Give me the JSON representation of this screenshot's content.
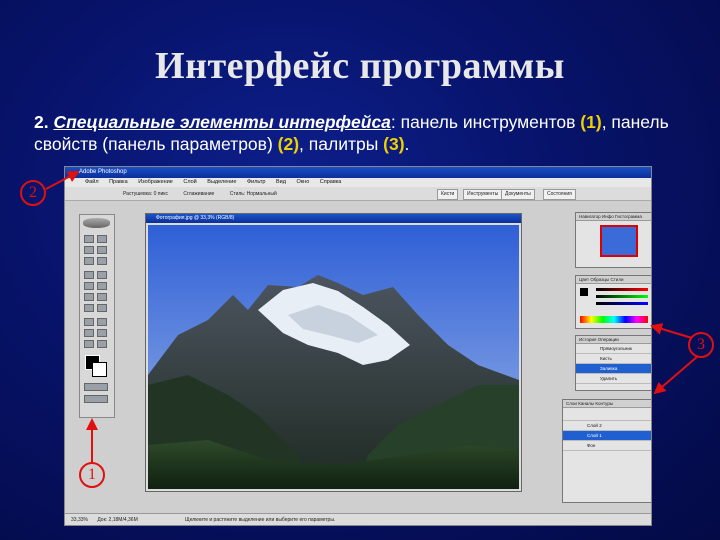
{
  "slide": {
    "title": "Интерфейс программы",
    "text": {
      "number": "2.",
      "heading": "Специальные элементы интерфейса",
      "part1": ": панель инструментов ",
      "ref1": "(1)",
      "part2": ", панель свойств (панель параметров) ",
      "ref2": "(2)",
      "part3": ", палитры ",
      "ref3": "(3)",
      "part4": "."
    }
  },
  "callouts": [
    "1",
    "2",
    "3"
  ],
  "screenshot": {
    "app_title": "Adobe Photoshop",
    "menu": [
      "Файл",
      "Правка",
      "Изображение",
      "Слой",
      "Выделение",
      "Фильтр",
      "Вид",
      "Окно",
      "Справка"
    ],
    "options": [
      "Растушевка: 0 пикс",
      "Сглаживание",
      "Стиль: Нормальный"
    ],
    "option_tabs": [
      "Кисти",
      "Инструменты",
      "Документы",
      "Состояния"
    ],
    "document_title": "Фотография.jpg @ 33,3% (RGB/8)",
    "palettes": {
      "navigator_tabs": "Навигатор  Инфо  Гистограмма",
      "color_tabs": "Цвет  Образцы  Стили",
      "history_tabs": "История  Операции",
      "history_rows": [
        "Прямоугольник",
        "Кисть",
        "Заливка",
        "Удалить"
      ],
      "layers_tabs": "Слои  Каналы  Контуры",
      "layers_rows": [
        "Слой 2",
        "Слой 1",
        "Фон"
      ]
    },
    "status": {
      "zoom": "33,33%",
      "doc_size": "Док: 2,18M/4,36M",
      "hint": "Щелкните и растяните выделение или выберите его параметры."
    }
  },
  "colors": {
    "accent": "#f0d000",
    "callout": "#e01010",
    "background": "#07136a"
  }
}
